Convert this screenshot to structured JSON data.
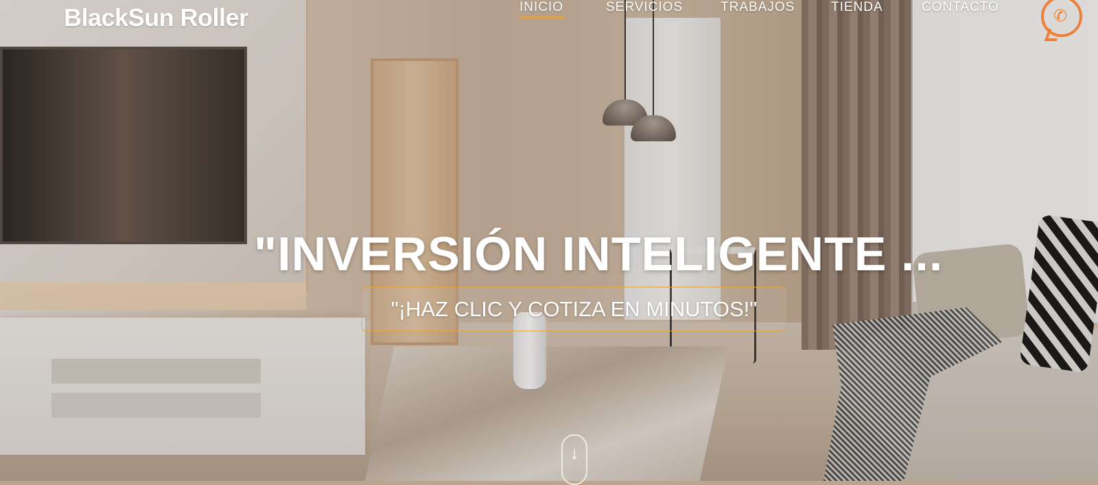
{
  "brand": {
    "logo_text": "BlackSun Roller"
  },
  "nav": {
    "items": [
      {
        "label": "INICIO",
        "active": true
      },
      {
        "label": "SERVICIOS",
        "active": false
      },
      {
        "label": "TRABAJOS",
        "active": false
      },
      {
        "label": "TIENDA",
        "active": false
      },
      {
        "label": "CONTACTO",
        "active": false
      }
    ],
    "whatsapp_icon": "whatsapp-icon"
  },
  "hero": {
    "headline": "\"INVERSIÓN INTELIGENTE ...",
    "cta_label": "\"¡HAZ CLIC Y COTIZA EN MINUTOS!\"",
    "scroll_icon": "arrow-down-icon"
  },
  "colors": {
    "accent": "#e0a44a",
    "whatsapp": "#ee7f38",
    "text": "#ffffff"
  }
}
